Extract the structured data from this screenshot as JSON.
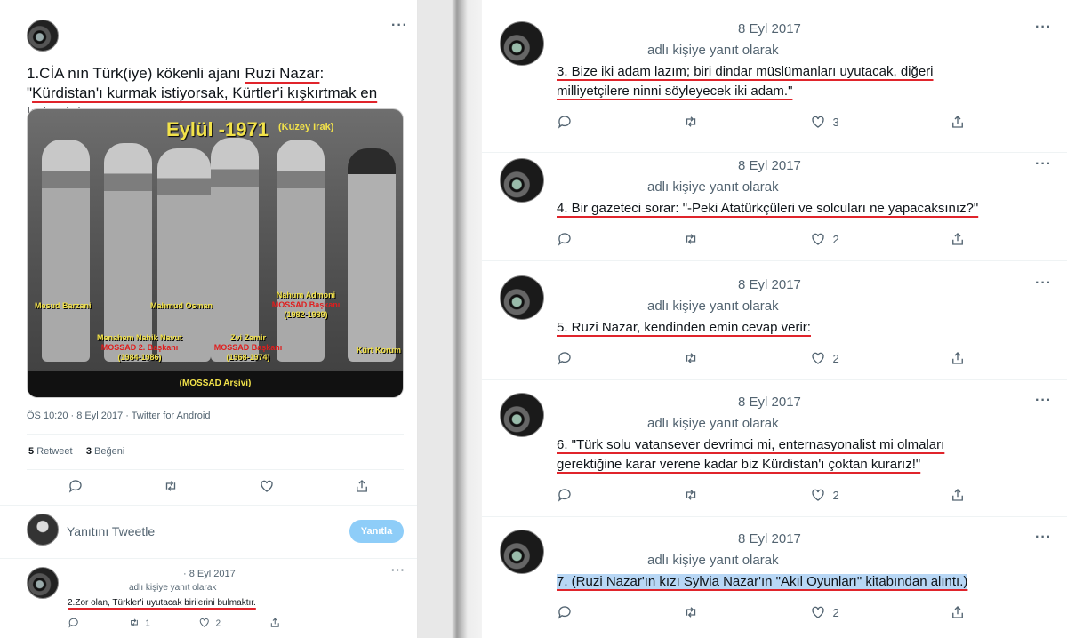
{
  "left": {
    "main_tweet": {
      "text_prefix": "1.CİA nın Türk(iye) kökenli ajanı ",
      "text_name": "Ruzi Nazar",
      "text_mid": ": \"",
      "text_quote": "Kürdistan'ı kurmak istiyorsak, Kürtler'i kışkırtmak en kolay iş!",
      "photo": {
        "title": "Eylül -1971",
        "subtitle": "(Kuzey Irak)",
        "captions": {
          "mesud": "Mesud Barzani",
          "mahmud": "Mahmud Osman",
          "nahum_name": "Nahum Admoni",
          "nahum_role": "MOSSAD Başkanı",
          "nahum_years": "(1982-1989)",
          "menahem_name": "Menahem Nahik Navut",
          "menahem_role": "MOSSAD 2. Başkanı",
          "menahem_years": "(1984-1986)",
          "zvi_name": "Zvi Zamir",
          "zvi_role": "MOSSAD Başkanı",
          "zvi_years": "(1968-1974)",
          "kurt": "Kürt Korum",
          "archive": "(MOSSAD Arşivi)"
        }
      },
      "meta": "ÖS 10:20 · 8 Eyl 2017 · Twitter for Android",
      "retweet_count": "5",
      "retweet_label": "Retweet",
      "like_count": "3",
      "like_label": "Beğeni"
    },
    "reply_prompt": "Yanıtını Tweetle",
    "reply_button": "Yanıtla",
    "next_tweet": {
      "date": "· 8 Eyl 2017",
      "replying": "adlı kişiye yanıt olarak",
      "text": "2.Zor olan, Türkler'i uyutacak birilerini bulmaktır.",
      "retweets": "1",
      "likes": "2"
    }
  },
  "right": {
    "tweets": [
      {
        "date": "8 Eyl 2017",
        "replying": "adlı kişiye yanıt olarak",
        "line1": "3. Bize iki adam lazım; biri dindar müslümanları uyutacak, diğeri",
        "line2": "milliyetçilere ninni söyleyecek iki adam.\"",
        "likes": "3"
      },
      {
        "date": "8 Eyl 2017",
        "replying": "adlı kişiye yanıt olarak",
        "line1": "4. Bir gazeteci sorar:  \"-Peki Atatürkçüleri ve solcuları ne yapacaksınız?\"",
        "line2": "",
        "likes": "2"
      },
      {
        "date": "8 Eyl 2017",
        "replying": "adlı kişiye yanıt olarak",
        "line1": "5. Ruzi Nazar, kendinden emin cevap verir:",
        "line2": "",
        "likes": "2"
      },
      {
        "date": "8 Eyl 2017",
        "replying": "adlı kişiye yanıt olarak",
        "line1": "6. \"Türk solu vatansever devrimci mi, enternasyonalist mi olmaları",
        "line2": "gerektiğine karar verene kadar biz Kürdistan'ı çoktan kurarız!\"",
        "likes": "2"
      },
      {
        "date": "8 Eyl 2017",
        "replying": "adlı kişiye yanıt olarak",
        "line1": "7. (Ruzi Nazar'ın kızı Sylvia Nazar'ın \"Akıl Oyunları\" kitabından alıntı.)",
        "line2": "",
        "likes": "2"
      }
    ]
  },
  "icons": [
    "reply-icon",
    "retweet-icon",
    "like-icon",
    "share-icon",
    "more-icon"
  ],
  "colors": {
    "underline": "#e0242b",
    "highlight": "#b8d7f5",
    "reply_button": "#8ecdf8"
  }
}
